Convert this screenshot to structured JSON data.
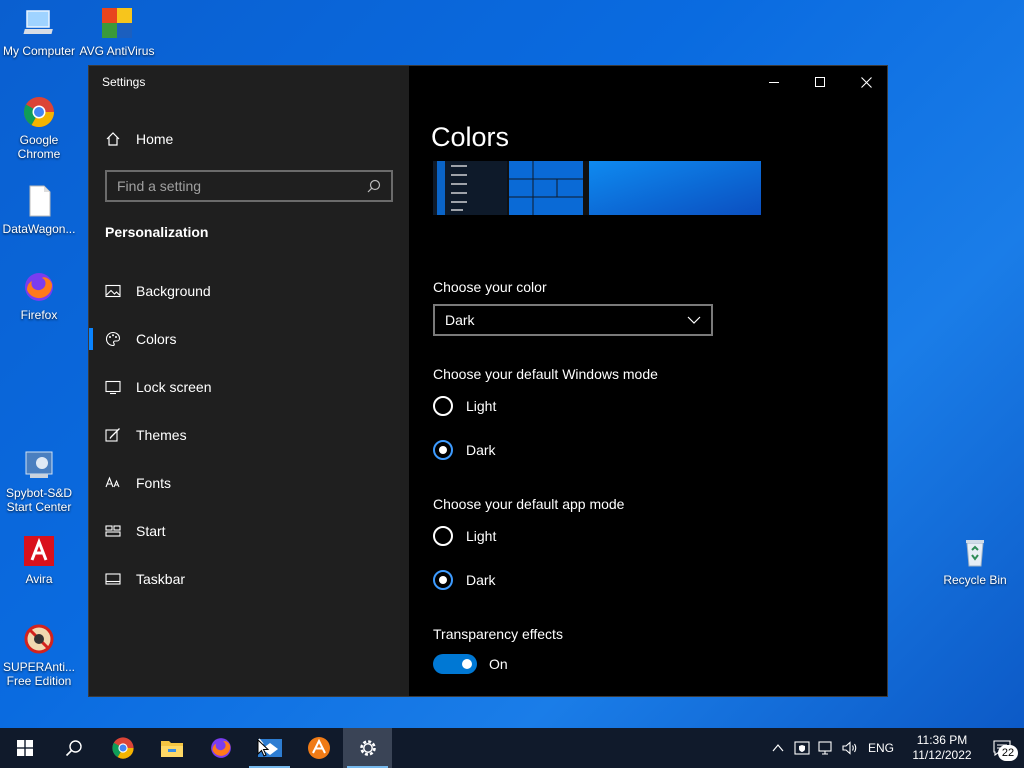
{
  "desktop": {
    "icons": [
      {
        "label": "My Computer"
      },
      {
        "label": "AVG AntiVirus FREE"
      },
      {
        "label": "Google Chrome"
      },
      {
        "label": "DataWagon..."
      },
      {
        "label": "Firefox"
      },
      {
        "label": "Spybot-S&D Start Center"
      },
      {
        "label": "Avira"
      },
      {
        "label": "SUPERAnti... Free Edition"
      },
      {
        "label": "Recycle Bin"
      }
    ]
  },
  "window": {
    "title": "Settings",
    "controls": [
      "minimize-icon",
      "maximize-icon",
      "close-icon"
    ]
  },
  "sidebar": {
    "home_label": "Home",
    "search_placeholder": "Find a setting",
    "section_title": "Personalization",
    "items": [
      {
        "label": "Background",
        "icon": "image-icon"
      },
      {
        "label": "Colors",
        "icon": "palette-icon",
        "active": true
      },
      {
        "label": "Lock screen",
        "icon": "lock-screen-icon"
      },
      {
        "label": "Themes",
        "icon": "themes-icon"
      },
      {
        "label": "Fonts",
        "icon": "fonts-icon"
      },
      {
        "label": "Start",
        "icon": "start-icon"
      },
      {
        "label": "Taskbar",
        "icon": "taskbar-icon"
      }
    ]
  },
  "main": {
    "title": "Colors",
    "choose_color": {
      "label": "Choose your color",
      "selected": "Dark"
    },
    "windows_mode": {
      "label": "Choose your default Windows mode",
      "options": [
        {
          "label": "Light",
          "checked": false
        },
        {
          "label": "Dark",
          "checked": true
        }
      ]
    },
    "app_mode": {
      "label": "Choose your default app mode",
      "options": [
        {
          "label": "Light",
          "checked": false
        },
        {
          "label": "Dark",
          "checked": true
        }
      ]
    },
    "transparency": {
      "label": "Transparency effects",
      "state": "On"
    }
  },
  "taskbar": {
    "apps": [
      "start-icon",
      "search-icon",
      "chrome-icon",
      "file-explorer-icon",
      "firefox-icon",
      "app-icon",
      "avast-icon",
      "settings-icon"
    ],
    "tray": {
      "language": "ENG",
      "time": "11:36 PM",
      "date": "11/12/2022",
      "notification_count": "22"
    }
  },
  "colors": {
    "accent": "#0078d4",
    "sidebar_bg": "#1f1f1f",
    "content_bg": "#000000",
    "taskbar_bg": "#101a2b"
  }
}
